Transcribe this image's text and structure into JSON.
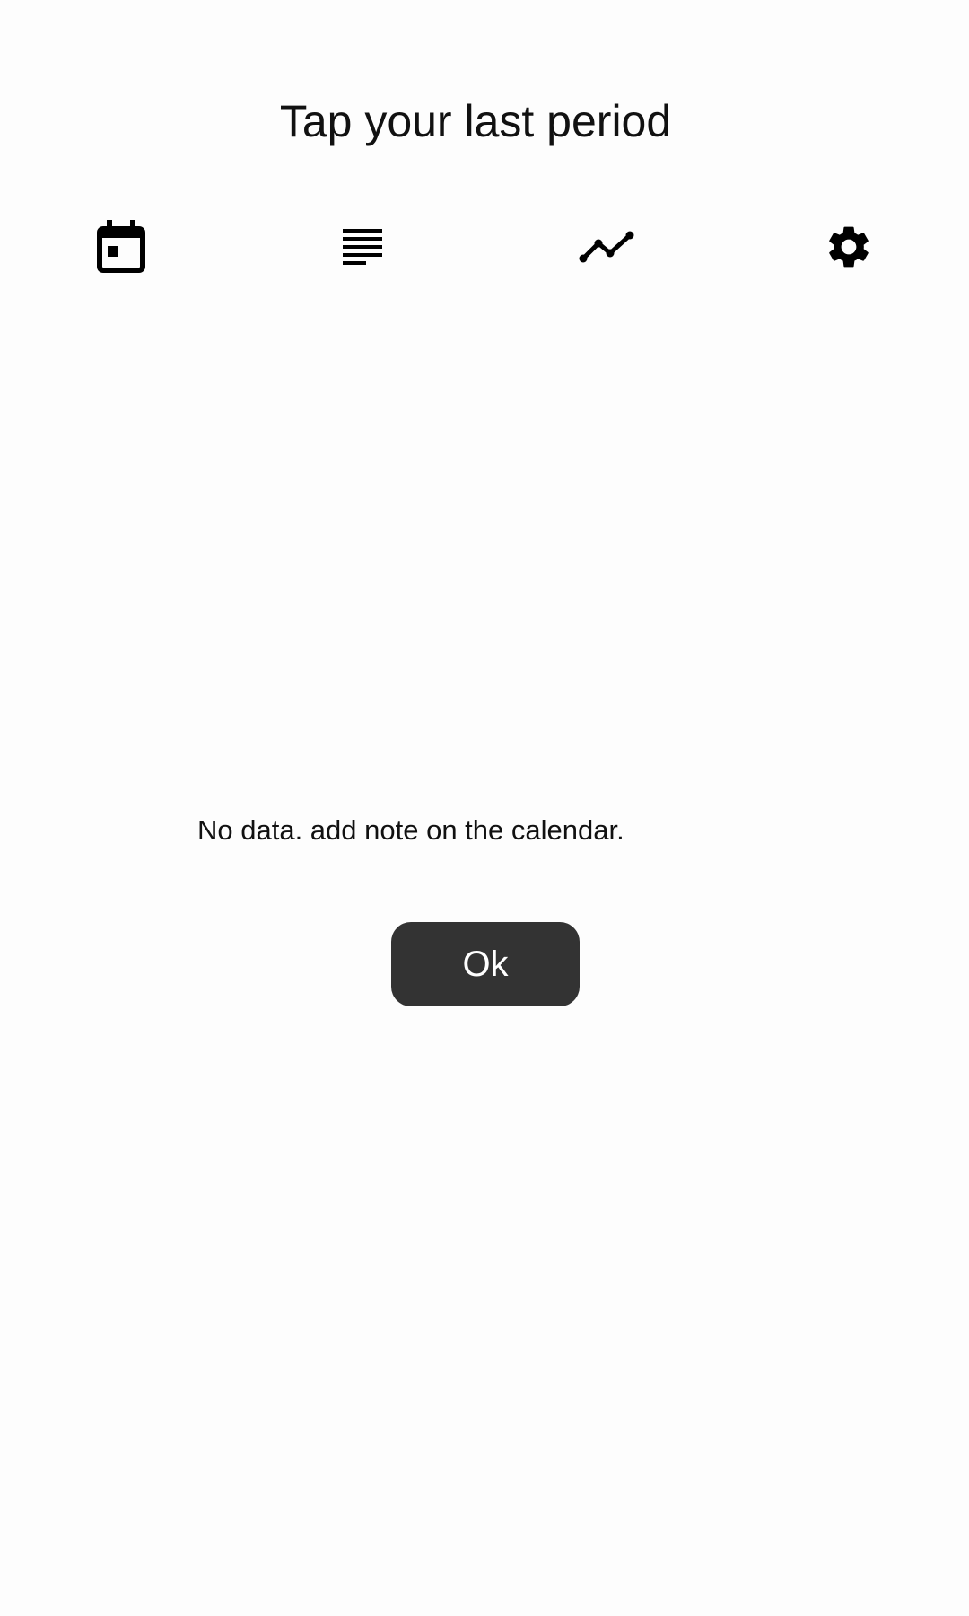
{
  "header": {
    "title": "Tap your last period"
  },
  "nav": {
    "items": [
      {
        "icon": "calendar-icon"
      },
      {
        "icon": "notes-list-icon"
      },
      {
        "icon": "trend-chart-icon"
      },
      {
        "icon": "gear-icon"
      }
    ]
  },
  "main": {
    "empty_message": "No data. add note on the calendar.",
    "ok_label": "Ok"
  },
  "colors": {
    "background": "#fdfdfd",
    "text": "#111111",
    "button_bg": "#333333",
    "button_text": "#ffffff"
  }
}
